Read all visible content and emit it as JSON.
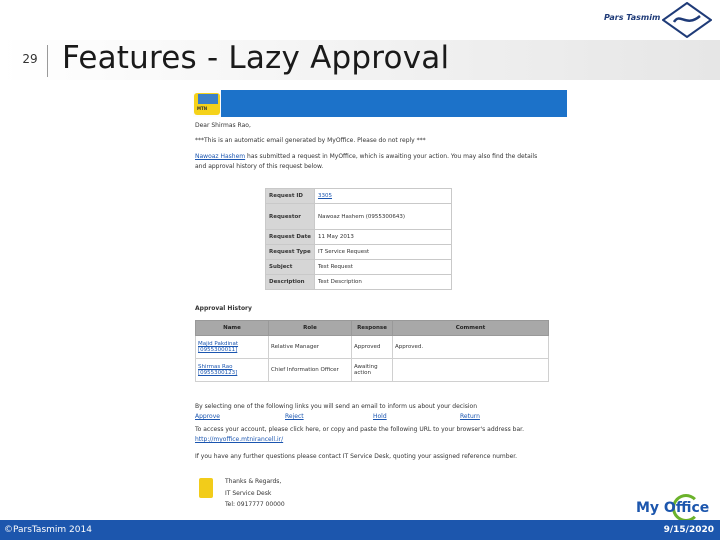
{
  "slide": {
    "number": "29",
    "title": "Features - Lazy Approval",
    "brand": "Pars Tasmim",
    "footer_left": "©ParsTasmim 2014",
    "footer_date": "9/15/2020",
    "product_logo": "My Office"
  },
  "email": {
    "greeting": "Dear Shirmas Rao,",
    "auto_notice": "***This is an automatic email generated by MyOffice. Please do not reply ***",
    "sender_name": "Nawoaz Hashem",
    "intro_rest": " has submitted a request in MyOffice, which is awaiting your action. You may also find the details",
    "intro_line2": "and approval history of this request below.",
    "request_fields": [
      {
        "label": "Request ID",
        "value": "3305"
      },
      {
        "label": "Requestor",
        "value": "Nawoaz Hashem (0955300643)"
      },
      {
        "label": "Request Date",
        "value": "11 May 2013"
      },
      {
        "label": "Request Type",
        "value": "IT Service Request"
      },
      {
        "label": "Subject",
        "value": "Test Request"
      },
      {
        "label": "Description",
        "value": "Test Description"
      }
    ],
    "history_title": "Approval History",
    "history_headers": [
      "Name",
      "Role",
      "Response",
      "Comment"
    ],
    "history_rows": [
      {
        "name": "Majid Pakdinat [0955300011]",
        "role": "Relative Manager",
        "response": "Approved",
        "comment": "Approved."
      },
      {
        "name": "Shirmas Rao [0955300123]",
        "role": "Chief Information Officer",
        "response": "Awaiting action",
        "comment": ""
      }
    ],
    "action_intro": "By selecting one of the following links you will send an email to inform us about your decision",
    "actions": [
      "Approve",
      "Reject",
      "Hold",
      "Return"
    ],
    "access_line1": "To access your account, please click here, or copy and paste the following URL to your browser's address bar.",
    "access_url": "http://myoffice.mtnirancell.ir/",
    "contact_line": "If you have any further questions please contact IT Service Desk, quoting your assigned reference number.",
    "thanks": "Thanks & Regards,",
    "signature_team": "IT Service Desk",
    "signature_phone": "Tel: 0917777 00000"
  },
  "colors": {
    "accent_blue": "#1c56ad",
    "banner_blue": "#1c72c9",
    "logo_green": "#6bb22b",
    "logo_yellow": "#f5d21a"
  }
}
